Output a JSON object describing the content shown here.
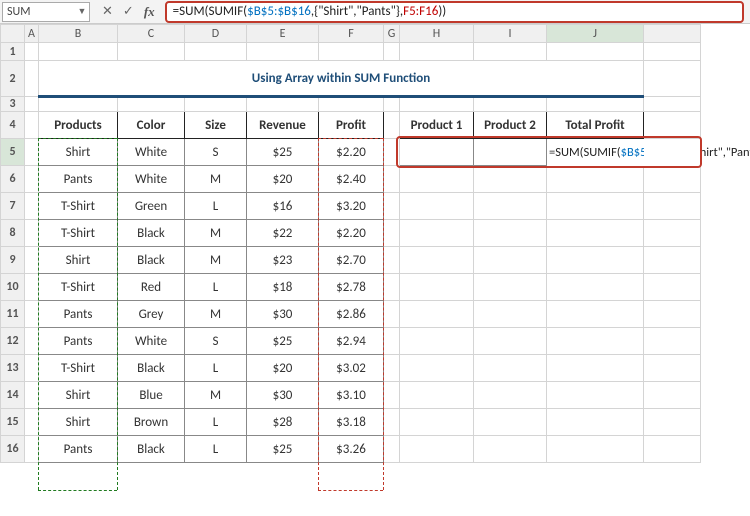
{
  "name_box": "SUM",
  "formula_bar": "=SUM(SUMIF($B$5:$B$16,{\"Shirt\",\"Pants\"},F5:F16))",
  "fx_label": "fx",
  "cancel_glyph": "✕",
  "enter_glyph": "✓",
  "columns": [
    "A",
    "B",
    "C",
    "D",
    "E",
    "F",
    "G",
    "H",
    "I",
    "J",
    ""
  ],
  "row_numbers": [
    "1",
    "2",
    "3",
    "4",
    "5",
    "6",
    "7",
    "8",
    "9",
    "10",
    "11",
    "12",
    "13",
    "14",
    "15",
    "16"
  ],
  "title": "Using Array within SUM Function",
  "headers": {
    "products": "Products",
    "color": "Color",
    "size": "Size",
    "revenue": "Revenue",
    "profit": "Profit"
  },
  "side_headers": {
    "p1": "Product 1",
    "p2": "Product 2",
    "total": "Total Profit"
  },
  "rows": [
    {
      "prod": "Shirt",
      "color": "White",
      "size": "S",
      "rev": "$25",
      "prof": "$2.20"
    },
    {
      "prod": "Pants",
      "color": "White",
      "size": "M",
      "rev": "$20",
      "prof": "$2.40"
    },
    {
      "prod": "T-Shirt",
      "color": "Green",
      "size": "L",
      "rev": "$16",
      "prof": "$3.20"
    },
    {
      "prod": "T-Shirt",
      "color": "Black",
      "size": "M",
      "rev": "$22",
      "prof": "$2.20"
    },
    {
      "prod": "Shirt",
      "color": "Black",
      "size": "M",
      "rev": "$23",
      "prof": "$2.70"
    },
    {
      "prod": "T-Shirt",
      "color": "Red",
      "size": "L",
      "rev": "$18",
      "prof": "$2.78"
    },
    {
      "prod": "Pants",
      "color": "Grey",
      "size": "M",
      "rev": "$30",
      "prof": "$2.86"
    },
    {
      "prod": "Pants",
      "color": "White",
      "size": "S",
      "rev": "$25",
      "prof": "$2.94"
    },
    {
      "prod": "T-Shirt",
      "color": "Black",
      "size": "L",
      "rev": "$20",
      "prof": "$3.02"
    },
    {
      "prod": "Shirt",
      "color": "Blue",
      "size": "M",
      "rev": "$30",
      "prof": "$3.10"
    },
    {
      "prod": "Shirt",
      "color": "Brown",
      "size": "L",
      "rev": "$28",
      "prof": "$3.18"
    },
    {
      "prod": "Pants",
      "color": "Black",
      "size": "L",
      "rev": "$25",
      "prof": "$3.26"
    }
  ],
  "cell_formula_tokens": [
    {
      "t": "=SUM(SUMIF(",
      "c": "tok-black"
    },
    {
      "t": "$B$5:$B$16",
      "c": "tok-blue"
    },
    {
      "t": ",{\"Shirt\",\"Pants\"},",
      "c": "tok-black"
    },
    {
      "t": "F5:F16",
      "c": "tok-red"
    },
    {
      "t": "))",
      "c": "tok-black"
    }
  ]
}
